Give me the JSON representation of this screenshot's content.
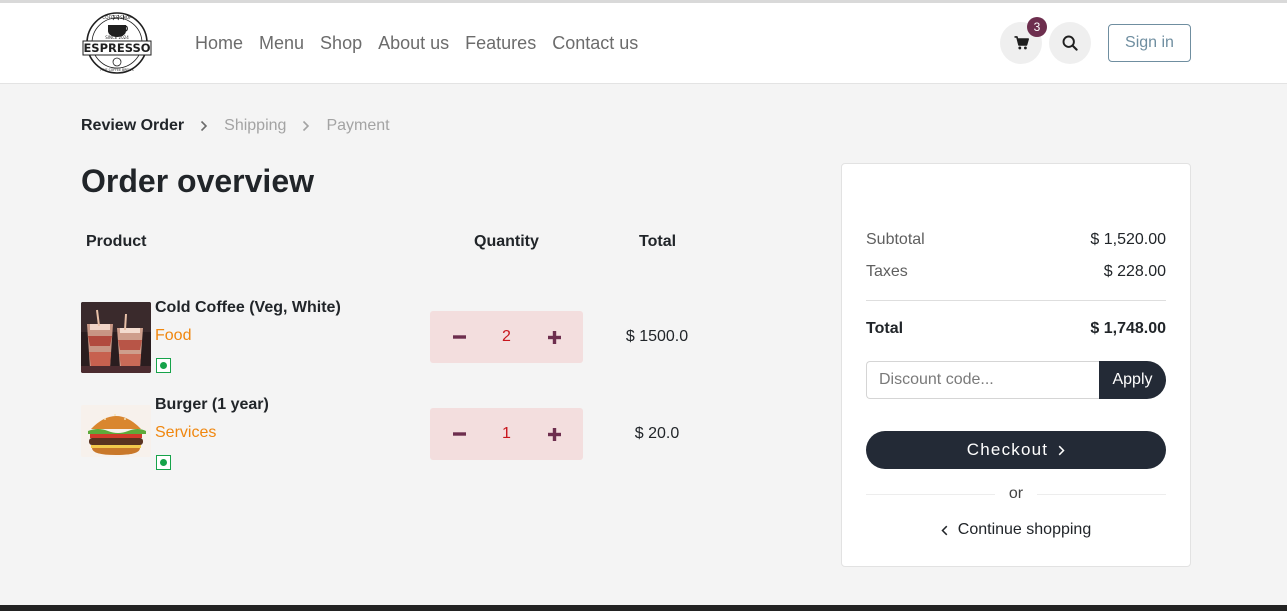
{
  "brand": {
    "logo_alt": "Coffee Shop Espresso",
    "logo_text_top": "COFFEE SHOP",
    "logo_text_main": "ESPRESSO",
    "logo_text_since": "SINCE 2024",
    "logo_text_bottom": "FINE COFFEE BREWS"
  },
  "nav": {
    "items": [
      {
        "label": "Home"
      },
      {
        "label": "Menu"
      },
      {
        "label": "Shop"
      },
      {
        "label": "About us"
      },
      {
        "label": "Features"
      },
      {
        "label": "Contact us"
      }
    ],
    "cart_count": "3",
    "cart_icon": "cart-icon",
    "search_icon": "search-icon",
    "signin_label": "Sign in"
  },
  "breadcrumb": {
    "steps": [
      {
        "label": "Review Order",
        "active": true
      },
      {
        "label": "Shipping",
        "active": false
      },
      {
        "label": "Payment",
        "active": false
      }
    ]
  },
  "page": {
    "title": "Order overview"
  },
  "table": {
    "headers": {
      "product": "Product",
      "quantity": "Quantity",
      "total": "Total"
    },
    "rows": [
      {
        "name": "Cold Coffee (Veg, White)",
        "category": "Food",
        "quantity": "2",
        "total": "$ 1500.0",
        "image_alt": "Cold coffee glasses"
      },
      {
        "name": "Burger (1 year)",
        "category": "Services",
        "quantity": "1",
        "total": "$ 20.0",
        "image_alt": "Burger"
      }
    ]
  },
  "summary": {
    "subtotal_label": "Subtotal",
    "subtotal_value": "$ 1,520.00",
    "taxes_label": "Taxes",
    "taxes_value": "$ 228.00",
    "total_label": "Total",
    "total_value": "$ 1,748.00",
    "discount_placeholder": "Discount code...",
    "discount_value": "",
    "apply_label": "Apply",
    "checkout_label": "Checkout",
    "or_label": "or",
    "continue_label": "Continue shopping"
  },
  "colors": {
    "accent_dark": "#232a36",
    "category_orange": "#f0870f",
    "badge": "#6d2e4e",
    "qty_bg": "#f3dede",
    "qty_value": "#c8161d",
    "veg_green": "#16a34a",
    "signin_outline": "#6f8ea0"
  }
}
